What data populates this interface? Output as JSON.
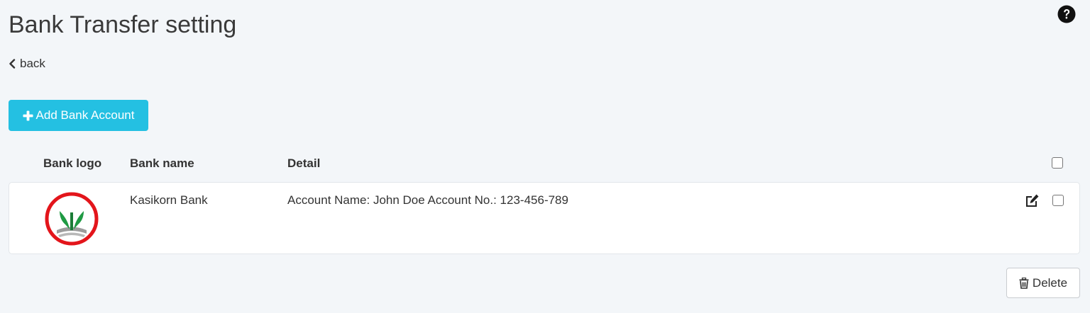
{
  "page": {
    "title": "Bank Transfer setting",
    "help_icon": "question-circle-icon"
  },
  "nav": {
    "back_label": "back",
    "back_icon": "chevron-left-icon"
  },
  "toolbar": {
    "add_label": "Add Bank Account",
    "add_icon": "plus-icon",
    "add_color": "#24c0e2"
  },
  "table": {
    "headers": {
      "logo": "Bank logo",
      "name": "Bank name",
      "detail": "Detail"
    },
    "select_all_checked": false,
    "rows": [
      {
        "logo_icon": "kasikorn-bank-logo",
        "bank_name": "Kasikorn Bank",
        "detail": "Account Name: John Doe Account No.: 123-456-789",
        "edit_icon": "edit-icon",
        "checked": false
      }
    ]
  },
  "footer": {
    "delete_label": "Delete",
    "delete_icon": "trash-icon"
  }
}
